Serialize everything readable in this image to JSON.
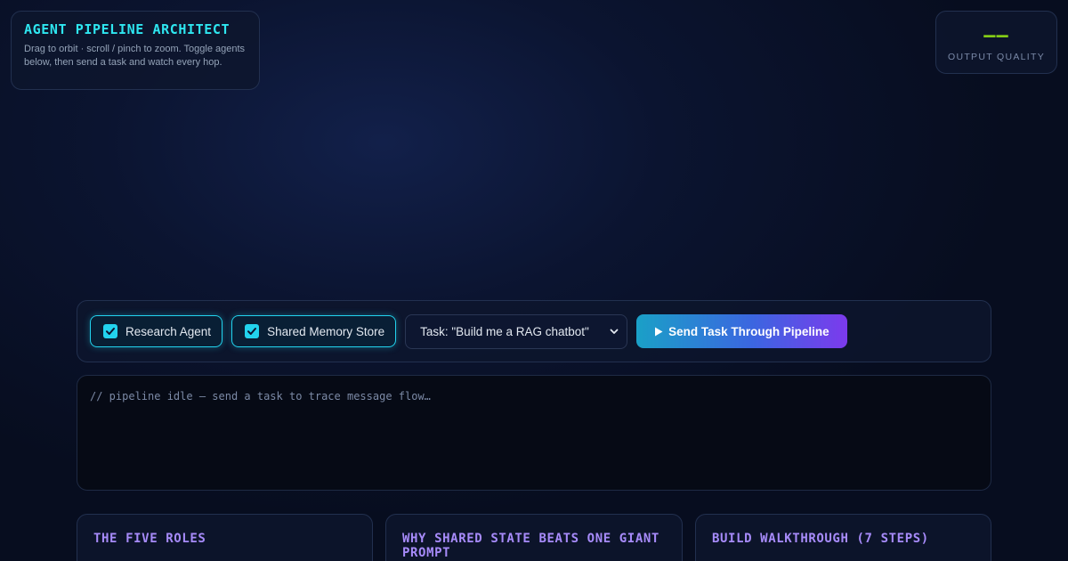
{
  "header": {
    "title": "AGENT PIPELINE ARCHITECT",
    "subtitle": "Drag to orbit · scroll / pinch to zoom. Toggle agents below, then send a task and watch every hop."
  },
  "quality": {
    "value": "——",
    "label": "OUTPUT QUALITY",
    "value_color": "#84cc16"
  },
  "controls": {
    "toggles": [
      {
        "label": "Research Agent",
        "checked": true
      },
      {
        "label": "Shared Memory Store",
        "checked": true
      }
    ],
    "task_select": {
      "selected": "Task: \"Build me a RAG chatbot\""
    },
    "send_button": {
      "label": "Send Task Through Pipeline",
      "icon": "play-icon"
    }
  },
  "log": {
    "text": "// pipeline idle — send a task to trace message flow…"
  },
  "cards": [
    {
      "title": "THE FIVE ROLES"
    },
    {
      "title": "WHY SHARED STATE BEATS ONE GIANT PROMPT"
    },
    {
      "title": "BUILD WALKTHROUGH (7 STEPS)"
    }
  ],
  "colors": {
    "accent_cyan": "#22d3ee",
    "title_cyan": "#2ee6f0",
    "card_title_purple": "#a78bfa",
    "quality_green": "#84cc16"
  }
}
